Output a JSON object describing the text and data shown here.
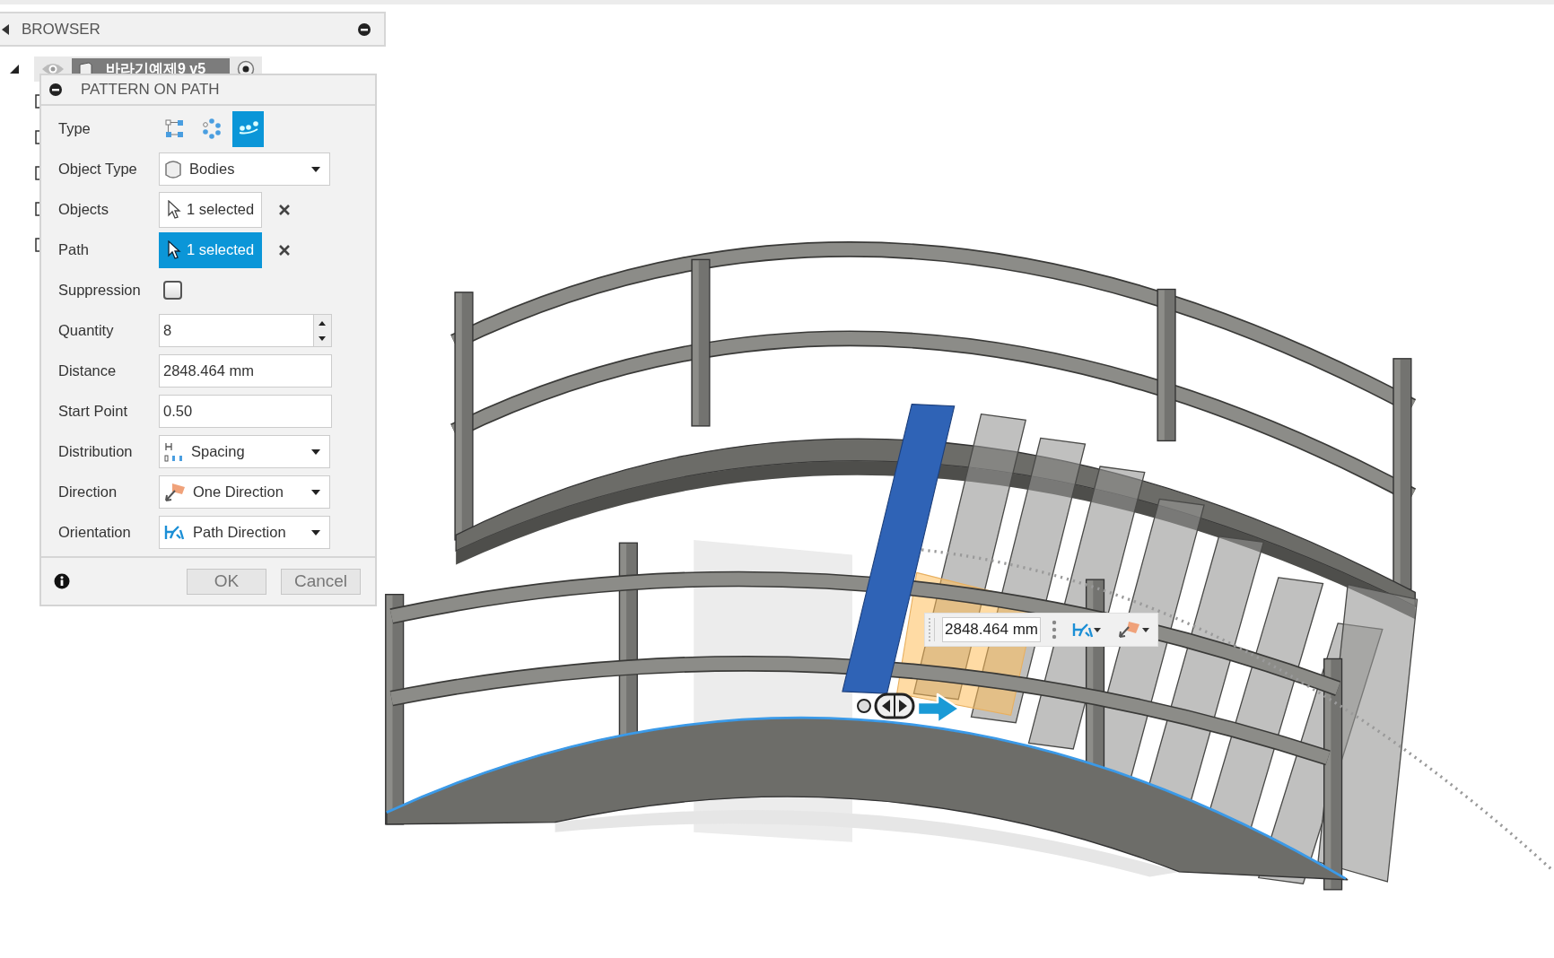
{
  "browser": {
    "title": "BROWSER",
    "root": {
      "name": "바라기예제9 v5",
      "expanded": true
    }
  },
  "dialog": {
    "title": "PATTERN ON PATH",
    "type": {
      "label": "Type",
      "options": [
        {
          "kind": "rectangular",
          "selected": false
        },
        {
          "kind": "circular",
          "selected": false
        },
        {
          "kind": "path",
          "selected": true
        }
      ]
    },
    "object_type": {
      "label": "Object Type",
      "value": "Bodies"
    },
    "objects": {
      "label": "Objects",
      "value": "1 selected",
      "active": false
    },
    "path": {
      "label": "Path",
      "value": "1 selected",
      "active": true
    },
    "suppression": {
      "label": "Suppression",
      "checked": false
    },
    "quantity": {
      "label": "Quantity",
      "value": "8"
    },
    "distance": {
      "label": "Distance",
      "value": "2848.464 mm"
    },
    "start_point": {
      "label": "Start Point",
      "value": "0.50"
    },
    "distribution": {
      "label": "Distribution",
      "value": "Spacing"
    },
    "direction": {
      "label": "Direction",
      "value": "One Direction"
    },
    "orientation": {
      "label": "Orientation",
      "value": "Path Direction"
    },
    "buttons": [
      "OK",
      "Cancel"
    ]
  },
  "canvas_widget": {
    "distance": "2848.464 mm"
  }
}
